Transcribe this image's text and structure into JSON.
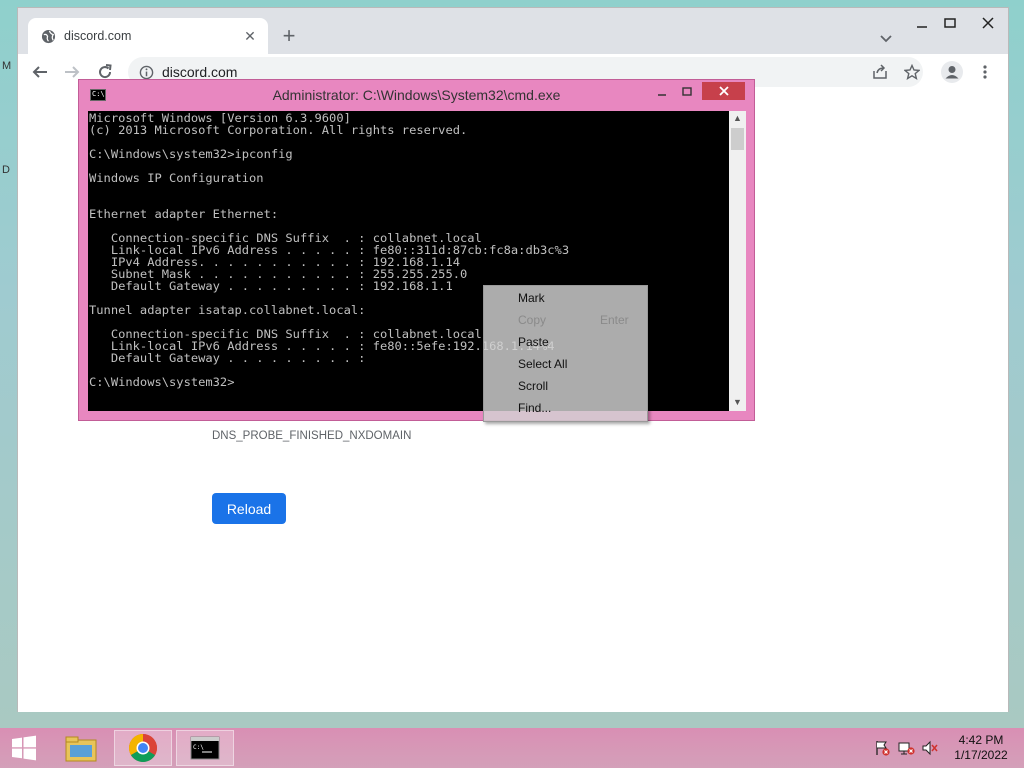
{
  "browser": {
    "tab_title": "discord.com",
    "url": "discord.com",
    "error_code": "DNS_PROBE_FINISHED_NXDOMAIN",
    "reload_label": "Reload"
  },
  "cmd": {
    "title": "Administrator: C:\\Windows\\System32\\cmd.exe",
    "lines": [
      "Microsoft Windows [Version 6.3.9600]",
      "(c) 2013 Microsoft Corporation. All rights reserved.",
      "",
      "C:\\Windows\\system32>ipconfig",
      "",
      "Windows IP Configuration",
      "",
      "",
      "Ethernet adapter Ethernet:",
      "",
      "   Connection-specific DNS Suffix  . : collabnet.local",
      "   Link-local IPv6 Address . . . . . : fe80::311d:87cb:fc8a:db3c%3",
      "   IPv4 Address. . . . . . . . . . . : 192.168.1.14",
      "   Subnet Mask . . . . . . . . . . . : 255.255.255.0",
      "   Default Gateway . . . . . . . . . : 192.168.1.1",
      "",
      "Tunnel adapter isatap.collabnet.local:",
      "",
      "   Connection-specific DNS Suffix  . : collabnet.local",
      "   Link-local IPv6 Address . . . . . : fe80::5efe:192.168.1.14%4",
      "   Default Gateway . . . . . . . . . :",
      "",
      "C:\\Windows\\system32>"
    ]
  },
  "context_menu": {
    "items": [
      "Mark",
      "Copy",
      "Paste",
      "Select All",
      "Scroll",
      "Find..."
    ],
    "copy_shortcut": "Enter"
  },
  "taskbar": {
    "time": "4:42 PM",
    "date": "1/17/2022"
  },
  "desktop": {
    "icon_letters": [
      "M",
      "D"
    ]
  }
}
